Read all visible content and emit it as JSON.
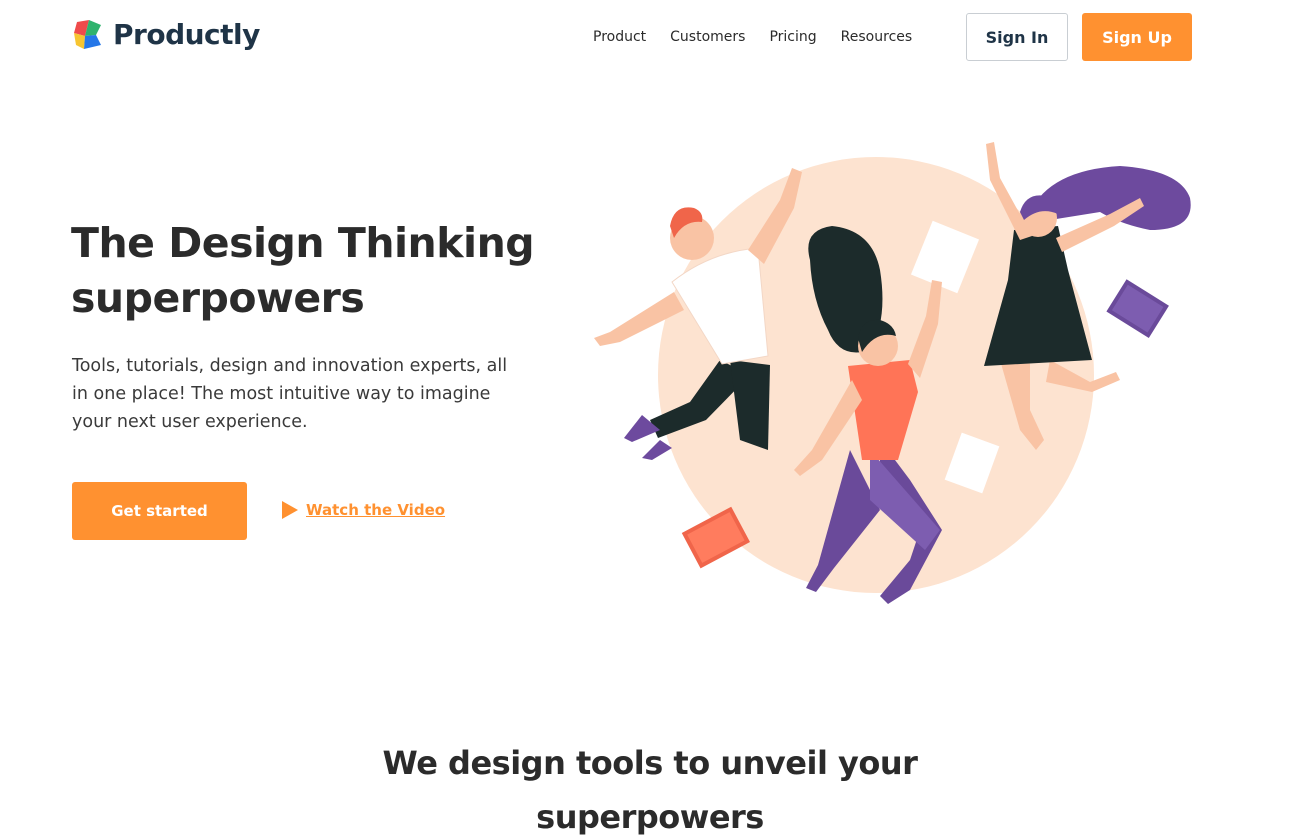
{
  "brand": {
    "name": "Productly",
    "accent_color": "#ff9130",
    "text_color": "#1f3447",
    "logo_icon": "productly-logo-icon"
  },
  "nav": {
    "items": [
      {
        "label": "Product"
      },
      {
        "label": "Customers"
      },
      {
        "label": "Pricing"
      },
      {
        "label": "Resources"
      }
    ],
    "sign_in_label": "Sign In",
    "sign_up_label": "Sign Up"
  },
  "hero": {
    "title": "The Design Thinking superpowers",
    "subtitle": "Tools, tutorials, design and innovation experts, all in one place! The most intuitive way to imagine your next user experience.",
    "cta_label": "Get started",
    "video_link_label": "Watch the Video",
    "video_icon": "play-icon",
    "illustration": "jumping-people-illustration"
  },
  "section": {
    "title": "We design tools to unveil your superpowers"
  }
}
